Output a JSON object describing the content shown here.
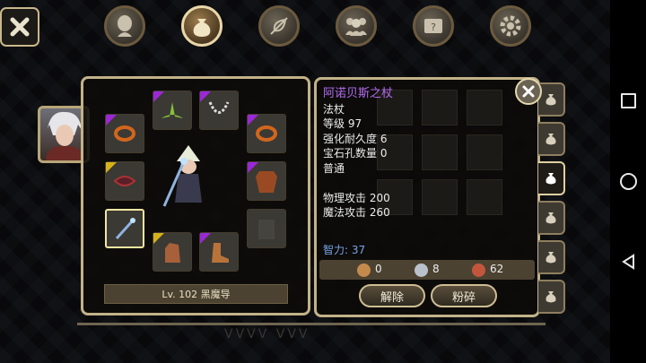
{
  "item": {
    "name": "阿诺贝斯之杖",
    "type": "法杖",
    "level": "等级 97",
    "durability": "强化耐久度 6",
    "sockets": "宝石孔数量 0",
    "grade": "普通",
    "phys_atk": "物理攻击 200",
    "mag_atk": "魔法攻击 260",
    "int_bonus": "智力: 37"
  },
  "costs": [
    {
      "icon": "copper-coin-icon",
      "value": "0",
      "color": "#c48a4c"
    },
    {
      "icon": "silver-coin-icon",
      "value": "8",
      "color": "#b9c2cc"
    },
    {
      "icon": "red-coin-icon",
      "value": "62",
      "color": "#c2563d"
    }
  ],
  "buttons": {
    "unequip": "解除",
    "smash": "粉碎"
  },
  "character": {
    "level_class": "Lv. 102 黑魔导"
  },
  "top_tabs": [
    {
      "name": "character-head-icon",
      "active": false
    },
    {
      "name": "bag-icon",
      "active": true
    },
    {
      "name": "skill-feather-icon",
      "active": false
    },
    {
      "name": "party-icon",
      "active": false
    },
    {
      "name": "quest-scroll-icon",
      "active": false
    },
    {
      "name": "settings-gear-icon",
      "active": false
    }
  ],
  "background_text": "VVVV VVV"
}
